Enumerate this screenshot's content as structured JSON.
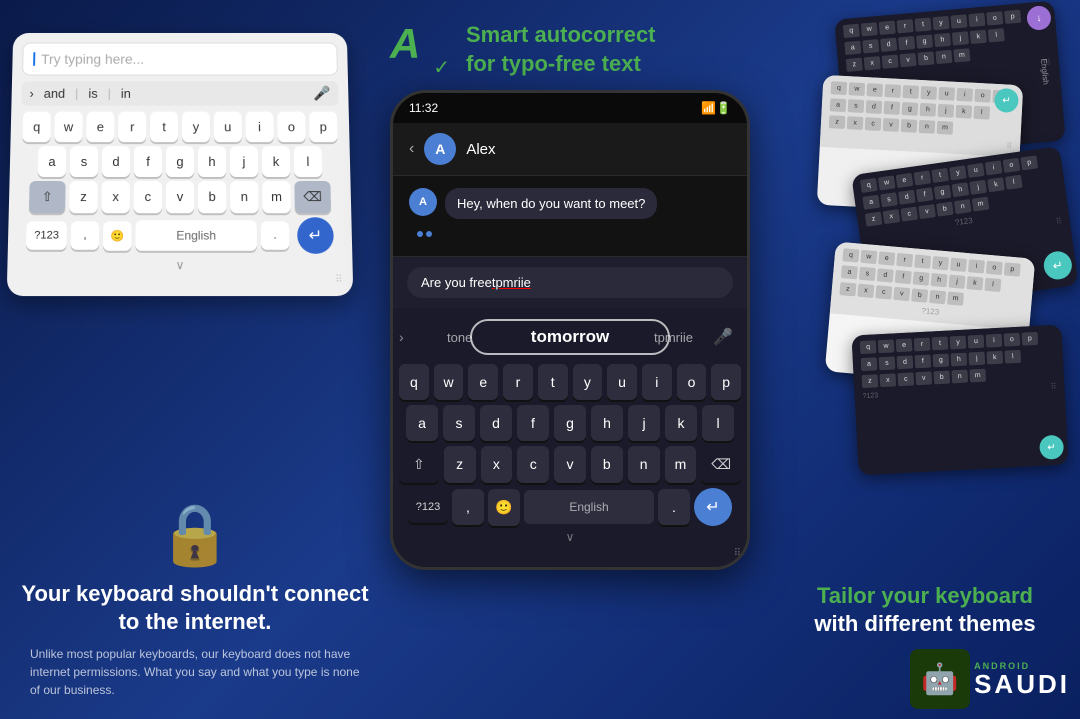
{
  "app": {
    "background": "#0a1a4a"
  },
  "left": {
    "keyboard": {
      "placeholder": "Try typing here...",
      "suggestions": [
        "and",
        "is",
        "in"
      ],
      "rows": [
        [
          "q",
          "w",
          "e",
          "r",
          "t",
          "y",
          "u",
          "i",
          "o",
          "p"
        ],
        [
          "a",
          "s",
          "d",
          "f",
          "g",
          "h",
          "j",
          "k",
          "l"
        ],
        [
          "z",
          "x",
          "c",
          "v",
          "b",
          "n",
          "m"
        ]
      ],
      "language": "English",
      "numbers": "?123"
    },
    "lock": {
      "title": "Your keyboard shouldn't connect to the internet.",
      "description": "Unlike most popular keyboards, our keyboard does not have internet permissions. What you say and what you type is none of our business."
    }
  },
  "middle": {
    "autocorrect": {
      "title": "Smart autocorrect",
      "subtitle": "for typo-free text"
    },
    "phone": {
      "time": "11:32",
      "contact": "Alex",
      "message": "Hey, when do you want to meet?",
      "typing": "Are you free tpmriie",
      "typo": "tpmriie",
      "suggestions": {
        "left": "tone",
        "center": "tomorrow",
        "right": "tpmriie"
      }
    },
    "keyboard": {
      "language": "English",
      "numbers": "?123"
    }
  },
  "right": {
    "tailor": {
      "line1": "Tailor your keyboard",
      "line2": "with different themes"
    },
    "saudi": {
      "label": "SAUDI",
      "android": "ANDROID"
    }
  }
}
